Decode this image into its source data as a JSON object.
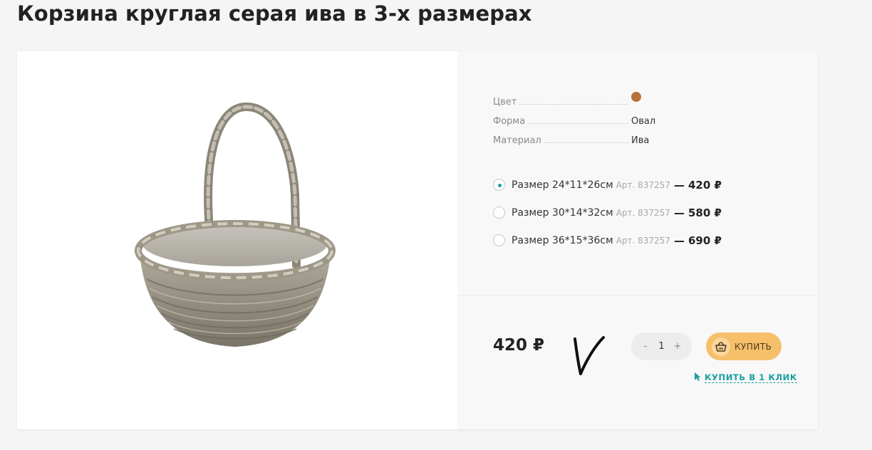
{
  "product": {
    "title": "Корзина круглая серая ива в 3-х размерах"
  },
  "properties": [
    {
      "label": "Цвет",
      "value": "",
      "color": "#b8713c"
    },
    {
      "label": "Форма",
      "value": "Овал"
    },
    {
      "label": "Материал",
      "value": "Ива"
    }
  ],
  "offers": [
    {
      "name": "Размер 24*11*26см",
      "art": "Арт. 837257",
      "dash": "—",
      "price": "420 ₽",
      "selected": true
    },
    {
      "name": "Размер 30*14*32см",
      "art": "Арт. 837257",
      "dash": "—",
      "price": "580 ₽",
      "selected": false
    },
    {
      "name": "Размер 36*15*36см",
      "art": "Арт. 837257",
      "dash": "—",
      "price": "690 ₽",
      "selected": false
    }
  ],
  "purchase": {
    "price": "420 ₽",
    "minus": "-",
    "quantity": "1",
    "plus": "+",
    "buy_label": "КУПИТЬ",
    "one_click_label": "КУПИТЬ В 1 КЛИК"
  },
  "colors": {
    "accent": "#1a9e9e",
    "buy_button": "#f6bf6a",
    "swatch": "#b8713c"
  },
  "icons": {
    "buy": "basket-icon",
    "one_click": "cursor-icon"
  }
}
